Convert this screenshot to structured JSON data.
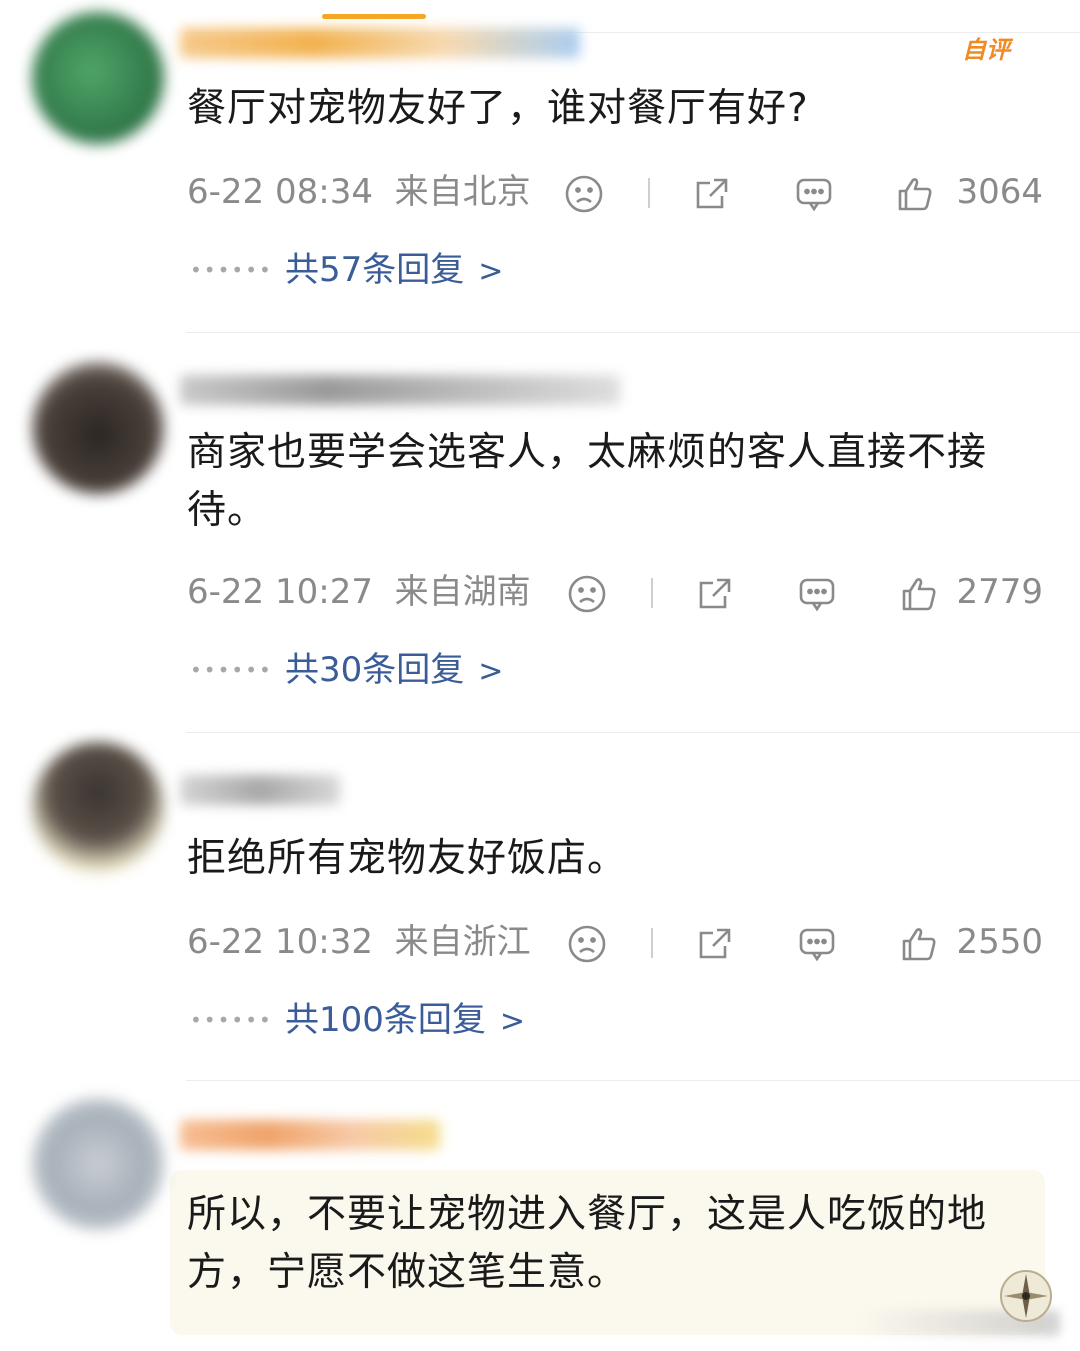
{
  "comments": [
    {
      "author_tag": "自评",
      "text": "餐厅对宠物友好了，谁对餐厅有好?",
      "time": "6-22 08:34",
      "location": "来自北京",
      "likes": "3064",
      "replies": "共57条回复",
      "colors": {
        "avatar": "#3b8a52",
        "name": "#f2b24f"
      }
    },
    {
      "text": "商家也要学会选客人，太麻烦的客人直接不接待。",
      "time": "6-22 10:27",
      "location": "来自湖南",
      "likes": "2779",
      "replies": "共30条回复",
      "colors": {
        "avatar": "#3a3430",
        "name": "#7a7a7a"
      }
    },
    {
      "text": "拒绝所有宠物友好饭店。",
      "time": "6-22 10:32",
      "location": "来自浙江",
      "likes": "2550",
      "replies": "共100条回复",
      "colors": {
        "avatar": "#4a4038",
        "name": "#9a9a9a"
      }
    },
    {
      "text": "所以，不要让宠物进入餐厅，这是人吃饭的地方，宁愿不做这笔生意。",
      "colors": {
        "avatar": "#b9c0c7",
        "name": "#f0a36a"
      }
    }
  ],
  "icons": {
    "dislike": "sad-face-icon",
    "share": "share-icon",
    "comment": "comment-bubble-icon",
    "like": "thumbs-up-icon",
    "more": "chevron-right-icon"
  },
  "theme": {
    "link_color": "#3a5c99",
    "meta_color": "#8a8a8a",
    "accent": "#f5a623"
  }
}
